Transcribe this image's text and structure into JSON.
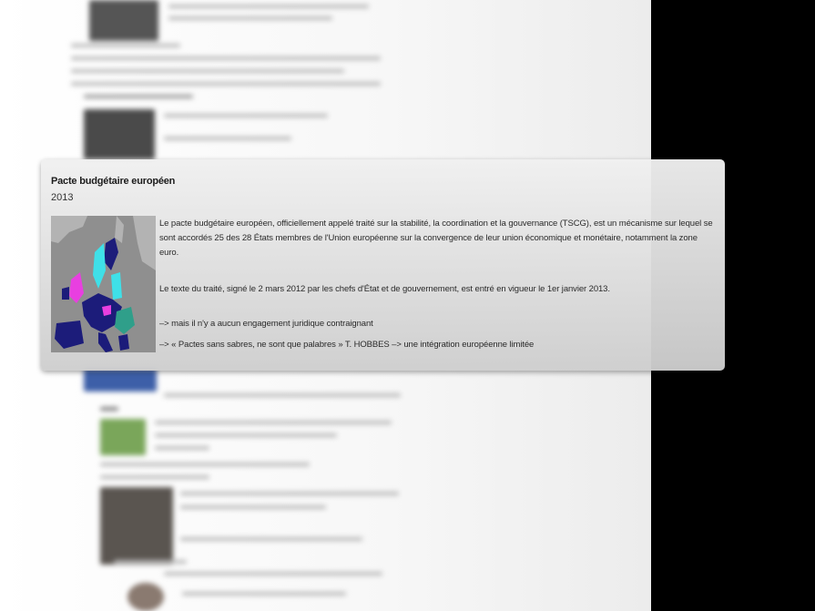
{
  "card": {
    "title": "Pacte budgétaire européen",
    "year": "2013",
    "paragraph1": "Le pacte budgétaire européen, officiellement appelé traité sur la stabilité, la coordination et la gouvernance (TSCG), est un mécanisme sur lequel se sont accordés 25 des 28 États membres de l'Union européenne sur la convergence de leur union économique et monétaire, notamment la zone euro.",
    "paragraph2": "Le texte du traité, signé le 2 mars 2012 par les chefs d'État et de gouvernement, est entré en vigueur le 1er janvier 2013.",
    "note1": "–> mais il n'y a aucun engagement juridique contraignant",
    "note2": "–> « Pactes sans sabres, ne sont que palabres » T. HOBBES   –> une intégration européenne limitée"
  },
  "map": {
    "icon": "europe-map",
    "colors": {
      "background": "#8f8f8f",
      "land": "#b3b3b3",
      "signatory": "#1c1c7a",
      "euro_zone": "#3fe0e8",
      "non_signatory": "#e83fe0",
      "other": "#2f9f8a"
    }
  }
}
